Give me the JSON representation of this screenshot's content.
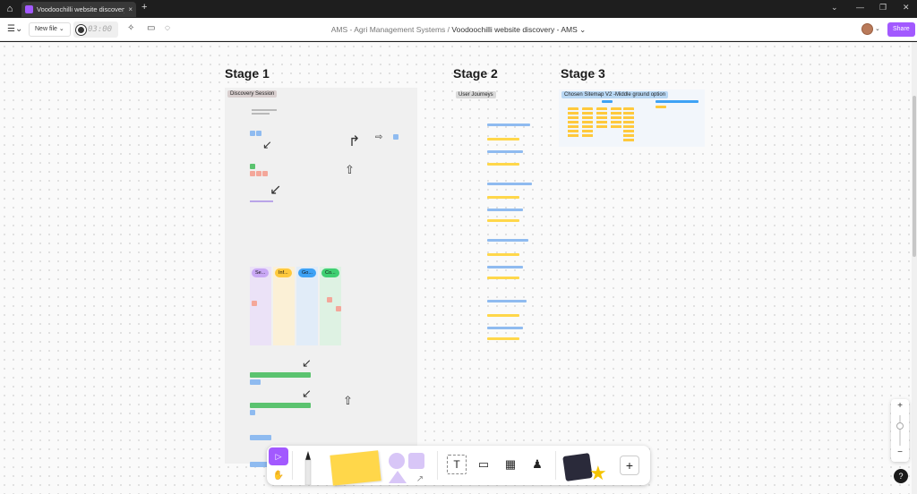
{
  "tab": {
    "title": "Voodoochilli website discovery - A",
    "close": "×"
  },
  "window": {
    "minimize": "⌄",
    "min2": "—",
    "max": "❐",
    "close": "✕"
  },
  "toolbar": {
    "new_file": "New file ⌄",
    "timer": "03:00",
    "breadcrumb_team": "AMS - Agri Management Systems",
    "breadcrumb_sep": "/",
    "breadcrumb_file": "Voodoochilli website discovery - AMS ⌄",
    "share": "Share"
  },
  "canvas": {
    "stage1": {
      "title": "Stage 1",
      "section_label": "Discovery Session"
    },
    "stage2": {
      "title": "Stage 2",
      "section_label": "User Journeys"
    },
    "stage3": {
      "title": "Stage 3",
      "section_label": "Chosen Sitemap V2  -Middle ground option"
    },
    "pills": [
      "Se...",
      "Inf...",
      "Go...",
      "Co..."
    ]
  },
  "bottom_bar": {
    "text_tool": "T",
    "plus": "+"
  },
  "zoom": {
    "plus": "+",
    "minus": "−"
  },
  "help": "?",
  "colors": {
    "accent": "#a259ff",
    "sticky_yellow": "#ffd74a",
    "blue": "#8fbbf0",
    "green": "#5bc36f",
    "salmon": "#f4a79a",
    "purple_pill": "#c9a8f5",
    "yellow_pill": "#ffc93c",
    "blue_pill": "#3ea2f5",
    "green_pill": "#3fcf72"
  }
}
